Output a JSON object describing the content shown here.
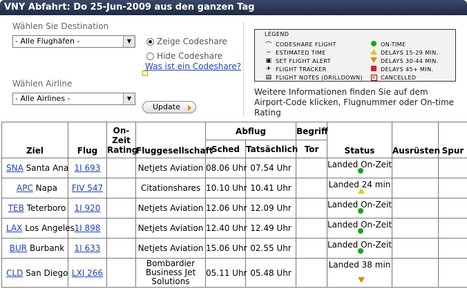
{
  "title": "VNY Abfahrt: Do 25-Jun-2009 aus den ganzen Tag",
  "filters": {
    "destination_label": "Wählen Sie Destination",
    "destination_value": "- Alle Flughäfen -",
    "airline_label": "Wählen Airline",
    "airline_value": "- Alle Airlines -",
    "codeshare_show": "Zeige Codeshare",
    "codeshare_hide": "Hide Codeshare",
    "codeshare_selected": "show",
    "codeshare_link": "Was ist ein Codeshare?",
    "update_button": "Update"
  },
  "legend": {
    "title": "LEGEND",
    "left": [
      {
        "icon": "codeshare-icon",
        "glyph": "⌒",
        "label": "CODESHARE FLIGHT"
      },
      {
        "icon": "estimated-time-icon",
        "glyph": "~",
        "label": "ESTIMATED TIME"
      },
      {
        "icon": "flight-alert-icon",
        "glyph": "▣",
        "label": "SET FLIGHT ALERT"
      },
      {
        "icon": "flight-tracker-icon",
        "glyph": "✈",
        "label": "FLIGHT TRACKER"
      },
      {
        "icon": "flight-notes-icon",
        "glyph": "▤",
        "label": "FLIGHT NOTES (DRILLDOWN)"
      }
    ],
    "right": [
      {
        "icon": "on-time-icon",
        "label": "ON-TIME"
      },
      {
        "icon": "delay-15-29-icon",
        "label": "DELAYS 15-29 MIN."
      },
      {
        "icon": "delay-30-44-icon",
        "label": "DELAYS 30-44 MIN."
      },
      {
        "icon": "delay-45-icon",
        "label": "DELAYS 45+ MIN."
      },
      {
        "icon": "cancelled-icon",
        "label": "CANCELLED"
      }
    ]
  },
  "info_text": "Weitere Informationen finden Sie auf dem Airport-Code klicken, Flugnummer oder On-time Rating",
  "table": {
    "headers": {
      "ziel": "Ziel",
      "flug": "Flug",
      "ontime": "On-Zeit Rating",
      "airline": "Fluggesellschaft",
      "abflug": "Abflug",
      "sched": "Sched",
      "actual": "Tatsächlich",
      "begriff": "Begriff",
      "tor": "Tor",
      "status": "Status",
      "equipment": "Ausrüsten",
      "spur": "Spur"
    },
    "rows": [
      {
        "code": "SNA",
        "city": "Santa Ana",
        "flight": "1I 693",
        "airline": "Netjets Aviation",
        "sched": "08.06 Uhr",
        "actual": "07.54 Uhr",
        "status": "Landed On-Zeit",
        "status_icon": "on-time-icon"
      },
      {
        "code": "APC",
        "city": "Napa",
        "flight": "FIV 547",
        "airline": "Citationshares",
        "sched": "10.10 Uhr",
        "actual": "10.41 Uhr",
        "status": "Landed 24 min",
        "status_icon": "delay-15-29-icon"
      },
      {
        "code": "TEB",
        "city": "Teterboro",
        "flight": "1I 920",
        "airline": "Netjets Aviation",
        "sched": "12.06 Uhr",
        "actual": "12.09 Uhr",
        "status": "Landed On-Zeit",
        "status_icon": "on-time-icon"
      },
      {
        "code": "LAX",
        "city": "Los Angeles",
        "flight": "1I 898",
        "airline": "Netjets Aviation",
        "sched": "12.40 Uhr",
        "actual": "12.49 Uhr",
        "status": "Landed On-Zeit",
        "status_icon": "on-time-icon"
      },
      {
        "code": "BUR",
        "city": "Burbank",
        "flight": "1I 633",
        "airline": "Netjets Aviation",
        "sched": "15.06 Uhr",
        "actual": "02.55 Uhr",
        "status": "Landed On-Zeit",
        "status_icon": "on-time-icon"
      },
      {
        "code": "CLD",
        "city": "San Diego",
        "flight": "LXJ 266",
        "airline": "Bombardier Business Jet Solutions",
        "sched": "05.11 Uhr",
        "actual": "05.48 Uhr",
        "status": "Landed 38 min",
        "status_icon": "delay-30-44-icon"
      }
    ]
  }
}
